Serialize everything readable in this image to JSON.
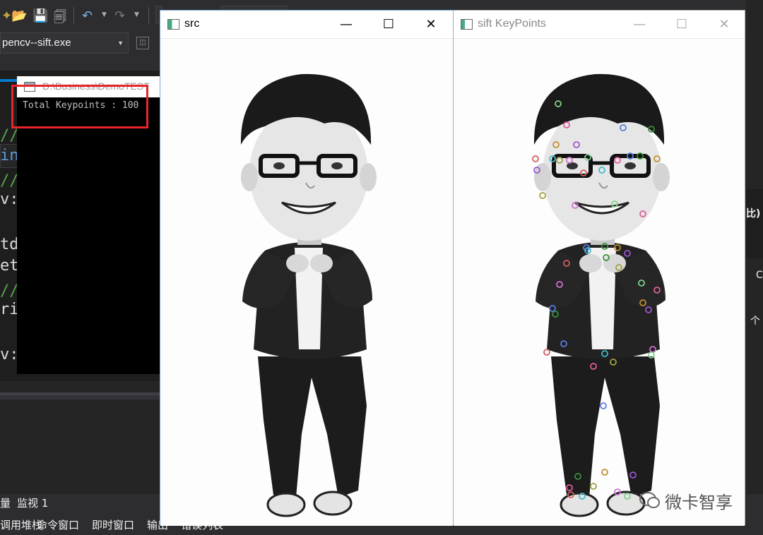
{
  "ide": {
    "startup_target": "pencv--sift.exe",
    "code_lines": [
      "//定",
      "int",
      "//创",
      "v:",
      "td",
      "et",
      "//提",
      "ri",
      "v:"
    ],
    "bottom_tabs_row1": [
      "量",
      "监视 1"
    ],
    "bottom_tabs_row2": [
      "调用堆栈",
      "命令窗口",
      "即时窗口",
      "输出",
      "错误列表"
    ],
    "right_fragments": [
      "比)",
      "C",
      "个"
    ]
  },
  "console": {
    "title": "D:\\Business\\DemoTEST",
    "output": "Total Keypoints : 100"
  },
  "src_window": {
    "title": "src",
    "minimize_label": "—",
    "maximize_label": "☐",
    "close_label": "✕"
  },
  "sift_window": {
    "title": "sift KeyPoints",
    "minimize_label": "—",
    "maximize_label": "☐",
    "close_label": "✕"
  },
  "watermark": "微卡智享",
  "colors": {
    "highlight_box": "#e8252a",
    "ide_background": "#2d2d30",
    "window_border": "#7aa7d8"
  },
  "keypoint_colors": [
    "#7fd28a",
    "#e05c9a",
    "#5b7be0",
    "#3a8f3a",
    "#c09030",
    "#9a56d0",
    "#d06060",
    "#46b8c8",
    "#a0a040",
    "#d070d0"
  ]
}
